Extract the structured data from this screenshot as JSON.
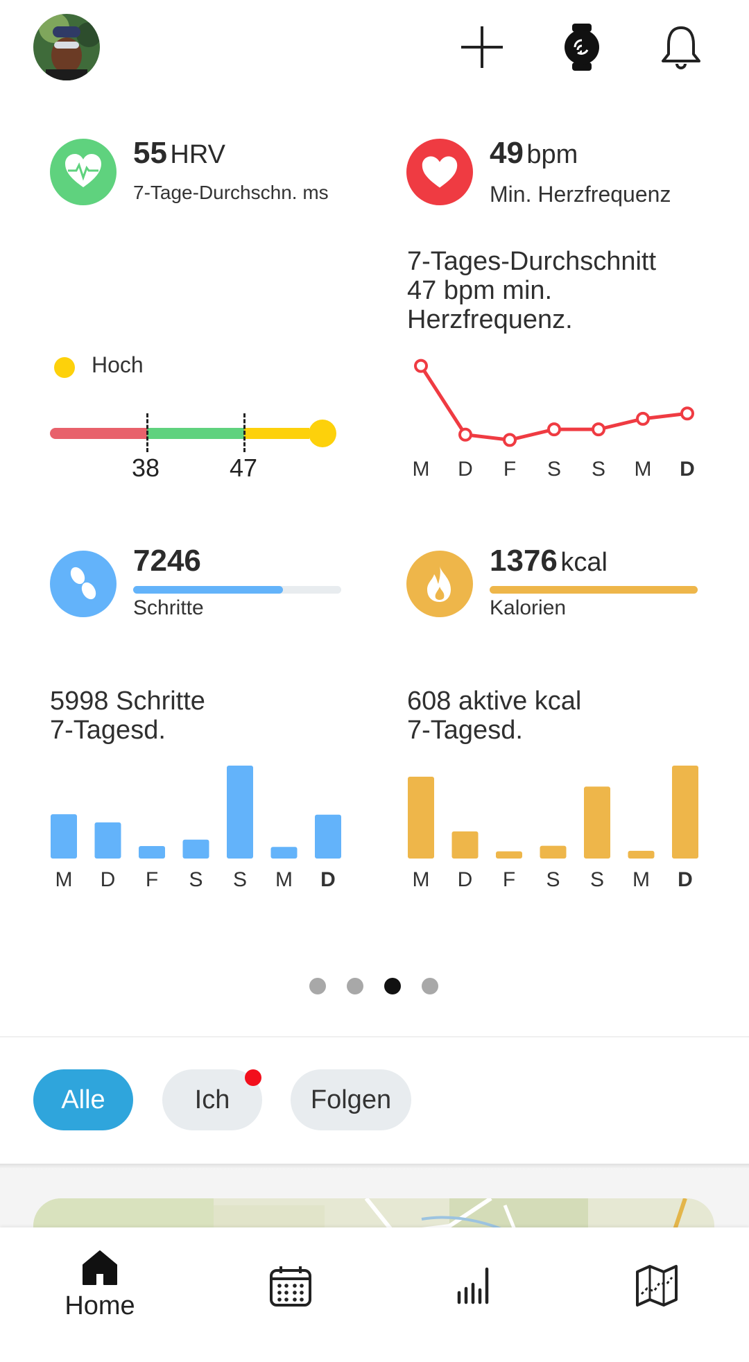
{
  "header": {
    "icons": [
      "avatar",
      "plus-icon",
      "watch-icon",
      "bell-icon"
    ]
  },
  "hrv": {
    "value": "55",
    "unit": "HRV",
    "subtitle": "7-Tage-Durchschn. ms",
    "level_label": "Hoch",
    "threshold_low": "38",
    "threshold_high": "47",
    "color": "#5fd27e"
  },
  "heart_rate": {
    "value": "49",
    "unit": "bpm",
    "subtitle": "Min. Herzfrequenz",
    "description_line1": "7-Tages-Durchschnitt",
    "description_line2": "47 bpm min.",
    "description_line3": "Herzfrequenz.",
    "color": "#ef3b42"
  },
  "steps": {
    "value": "7246",
    "subtitle": "Schritte",
    "progress": 0.72,
    "description_line1": "5998 Schritte",
    "description_line2": "7-Tagesd.",
    "color": "#63b3fa"
  },
  "calories": {
    "value": "1376",
    "unit": "kcal",
    "subtitle": "Kalorien",
    "progress": 1.0,
    "description_line1": "608 aktive kcal",
    "description_line2": "7-Tagesd.",
    "color": "#eeb64a"
  },
  "days": [
    "M",
    "D",
    "F",
    "S",
    "S",
    "M",
    "D"
  ],
  "chart_data": [
    {
      "type": "line",
      "categories": [
        "M",
        "D",
        "F",
        "S",
        "S",
        "M",
        "D"
      ],
      "values": [
        59,
        46,
        45,
        47,
        47,
        49,
        50
      ]
    },
    {
      "type": "bar",
      "categories": [
        "M",
        "D",
        "F",
        "S",
        "S",
        "M",
        "D"
      ],
      "values": [
        5150,
        4200,
        1450,
        2200,
        10800,
        1350,
        5100
      ]
    },
    {
      "type": "bar",
      "categories": [
        "M",
        "D",
        "F",
        "S",
        "S",
        "M",
        "D"
      ],
      "values": [
        740,
        245,
        65,
        115,
        650,
        70,
        840
      ]
    }
  ],
  "pager": {
    "count": 4,
    "active": 3
  },
  "filters": [
    {
      "label": "Alle",
      "active": true
    },
    {
      "label": "Ich",
      "active": false,
      "badge": true
    },
    {
      "label": "Folgen",
      "active": false
    }
  ],
  "nav": {
    "home_label": "Home",
    "items": [
      "home-icon",
      "calendar-icon",
      "stats-icon",
      "map-icon"
    ]
  }
}
